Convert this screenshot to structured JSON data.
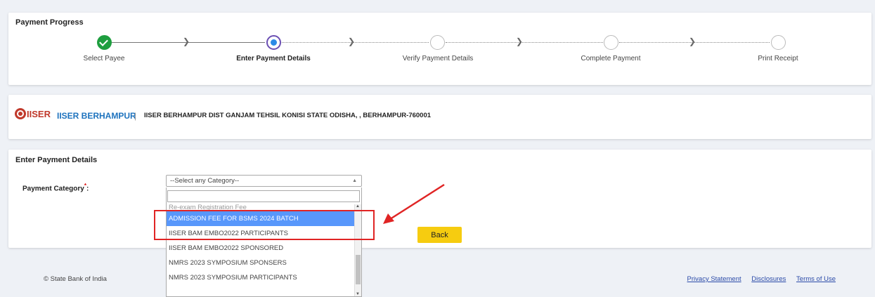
{
  "progress": {
    "title": "Payment Progress",
    "steps": [
      {
        "label": "Select Payee",
        "state": "completed"
      },
      {
        "label": "Enter Payment Details",
        "state": "current"
      },
      {
        "label": "Verify Payment Details",
        "state": "pending"
      },
      {
        "label": "Complete Payment",
        "state": "pending"
      },
      {
        "label": "Print Receipt",
        "state": "pending"
      }
    ]
  },
  "payee": {
    "name": "IISER BERHAMPUR",
    "separator": "|",
    "address": "IISER BERHAMPUR DIST GANJAM TEHSIL KONISI STATE ODISHA, , BERHAMPUR-760001"
  },
  "details": {
    "title": "Enter Payment Details",
    "category_label": "Payment Category",
    "required_mark": "*",
    "label_suffix": ":",
    "select_placeholder": "--Select any Category--",
    "back_label": "Back",
    "options": [
      "Re-exam Registration Fee",
      "ADMISSION FEE FOR BSMS 2024 BATCH",
      "IISER BAM EMBO2022 PARTICIPANTS",
      "IISER BAM EMBO2022 SPONSORED",
      "NMRS 2023 SYMPOSIUM SPONSERS",
      "NMRS 2023 SYMPOSIUM PARTICIPANTS"
    ],
    "highlighted_option": "ADMISSION FEE FOR BSMS 2024 BATCH"
  },
  "footer": {
    "copyright": "© State Bank of India",
    "links": [
      "Privacy Statement",
      "Disclosures",
      "Terms of Use"
    ]
  },
  "colors": {
    "completed": "#1e9e3f",
    "current_ring": "#6b4fb3",
    "current_dot": "#2c8be6",
    "payee_name": "#1e73be",
    "highlight": "#5897fb",
    "back_button": "#f6cc10",
    "annotation": "#e02424"
  }
}
